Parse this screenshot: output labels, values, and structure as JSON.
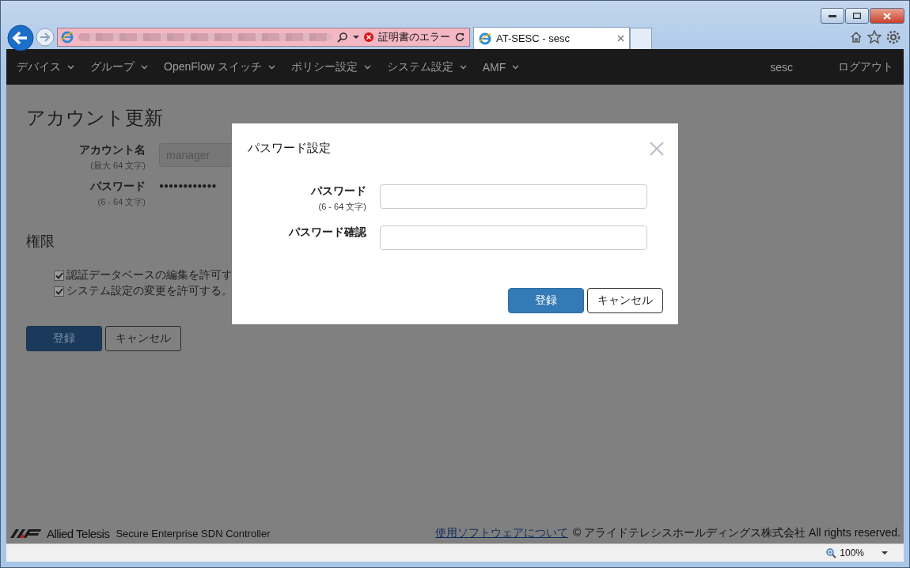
{
  "browser": {
    "cert_error": "証明書のエラー",
    "tabs": [
      {
        "title": "AT-SESC - sesc",
        "selected": true
      }
    ]
  },
  "nav": {
    "items": [
      {
        "label": "デバイス",
        "dropdown": true
      },
      {
        "label": "グループ",
        "dropdown": true
      },
      {
        "label": "OpenFlow スイッチ",
        "dropdown": true
      },
      {
        "label": "ポリシー設定",
        "dropdown": true
      },
      {
        "label": "システム設定",
        "dropdown": true
      },
      {
        "label": "AMF",
        "dropdown": true
      }
    ],
    "user": "sesc",
    "logout": "ログアウト"
  },
  "page": {
    "title": "アカウント更新",
    "fields": [
      {
        "label": "アカウント名",
        "hint": "(最大 64 文字)",
        "kind": "text",
        "value": "manager"
      },
      {
        "label": "パスワード",
        "hint": "(6 - 64 文字)",
        "kind": "masked",
        "value": "●●●●●●●●●●●●"
      }
    ],
    "permissions_title": "権限",
    "permissions": [
      {
        "label": "認証データベースの編集を許可す",
        "checked": true
      },
      {
        "label": "システム設定の変更を許可する。",
        "checked": true
      }
    ],
    "buttons": [
      {
        "label": "登録",
        "kind": "primary"
      },
      {
        "label": "キャンセル",
        "kind": "default"
      }
    ]
  },
  "modal": {
    "title": "パスワード設定",
    "fields": [
      {
        "label": "パスワード",
        "hint": "(6 - 64 文字)"
      },
      {
        "label": "パスワード確認"
      }
    ],
    "buttons": [
      {
        "label": "登録",
        "kind": "primary"
      },
      {
        "label": "キャンセル",
        "kind": "default"
      }
    ]
  },
  "footer": {
    "brand": "Allied Telesis",
    "product": "Secure Enterprise SDN Controller",
    "link": "使用ソフトウェアについて",
    "copyright": "© アライドテレシスホールディングス株式会社 All rights reserved."
  },
  "status_bar": {
    "zoom": "100%"
  }
}
